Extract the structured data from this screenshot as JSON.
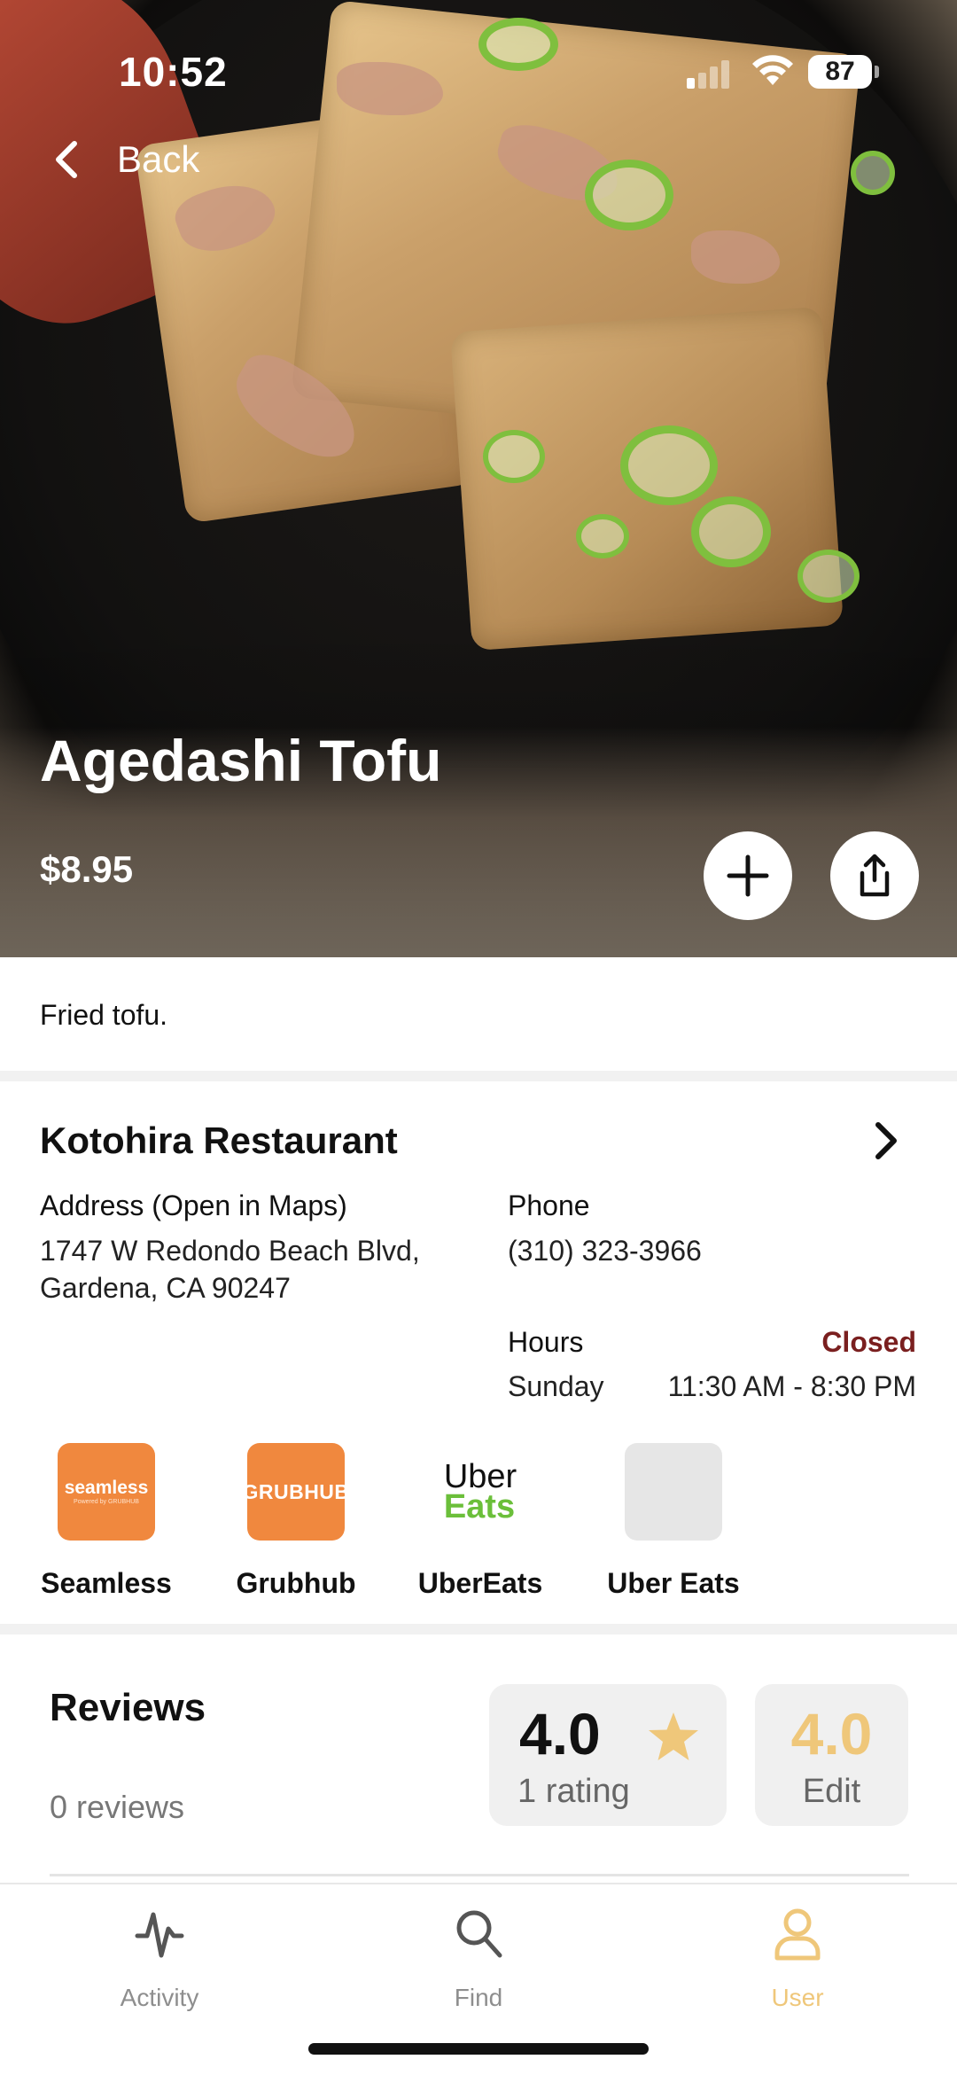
{
  "status_bar": {
    "time": "10:52",
    "battery": "87"
  },
  "nav": {
    "back_label": "Back"
  },
  "dish": {
    "name": "Agedashi Tofu",
    "price": "$8.95",
    "description": "Fried tofu."
  },
  "restaurant": {
    "name": "Kotohira Restaurant",
    "address_label": "Address (Open in Maps)",
    "address_line1": "1747 W Redondo Beach Blvd,",
    "address_line2": "Gardena, CA 90247",
    "phone_label": "Phone",
    "phone": "(310) 323-3966",
    "hours_label": "Hours",
    "status": "Closed",
    "day": "Sunday",
    "hours": "11:30 AM - 8:30 PM"
  },
  "delivery": [
    {
      "name": "Seamless",
      "logo_text": "seamless",
      "logo_sub": "Powered by GRUBHUB"
    },
    {
      "name": "Grubhub",
      "logo_text": "GRUBHUB"
    },
    {
      "name": "UberEats",
      "logo_text_1": "Uber",
      "logo_text_2": "Eats"
    },
    {
      "name": "Uber Eats"
    }
  ],
  "reviews": {
    "title": "Reviews",
    "count": "0 reviews",
    "avg": "4.0",
    "rating_count": "1 rating",
    "my_rating": "4.0",
    "edit_label": "Edit"
  },
  "tabs": [
    {
      "label": "Activity",
      "icon": "activity-icon"
    },
    {
      "label": "Find",
      "icon": "search-icon"
    },
    {
      "label": "User",
      "icon": "user-icon",
      "active": true
    }
  ],
  "colors": {
    "accent": "#efc77a",
    "closed": "#7a1f1f",
    "delivery_orange": "#f0883e",
    "uber_green": "#6bbf3a"
  }
}
